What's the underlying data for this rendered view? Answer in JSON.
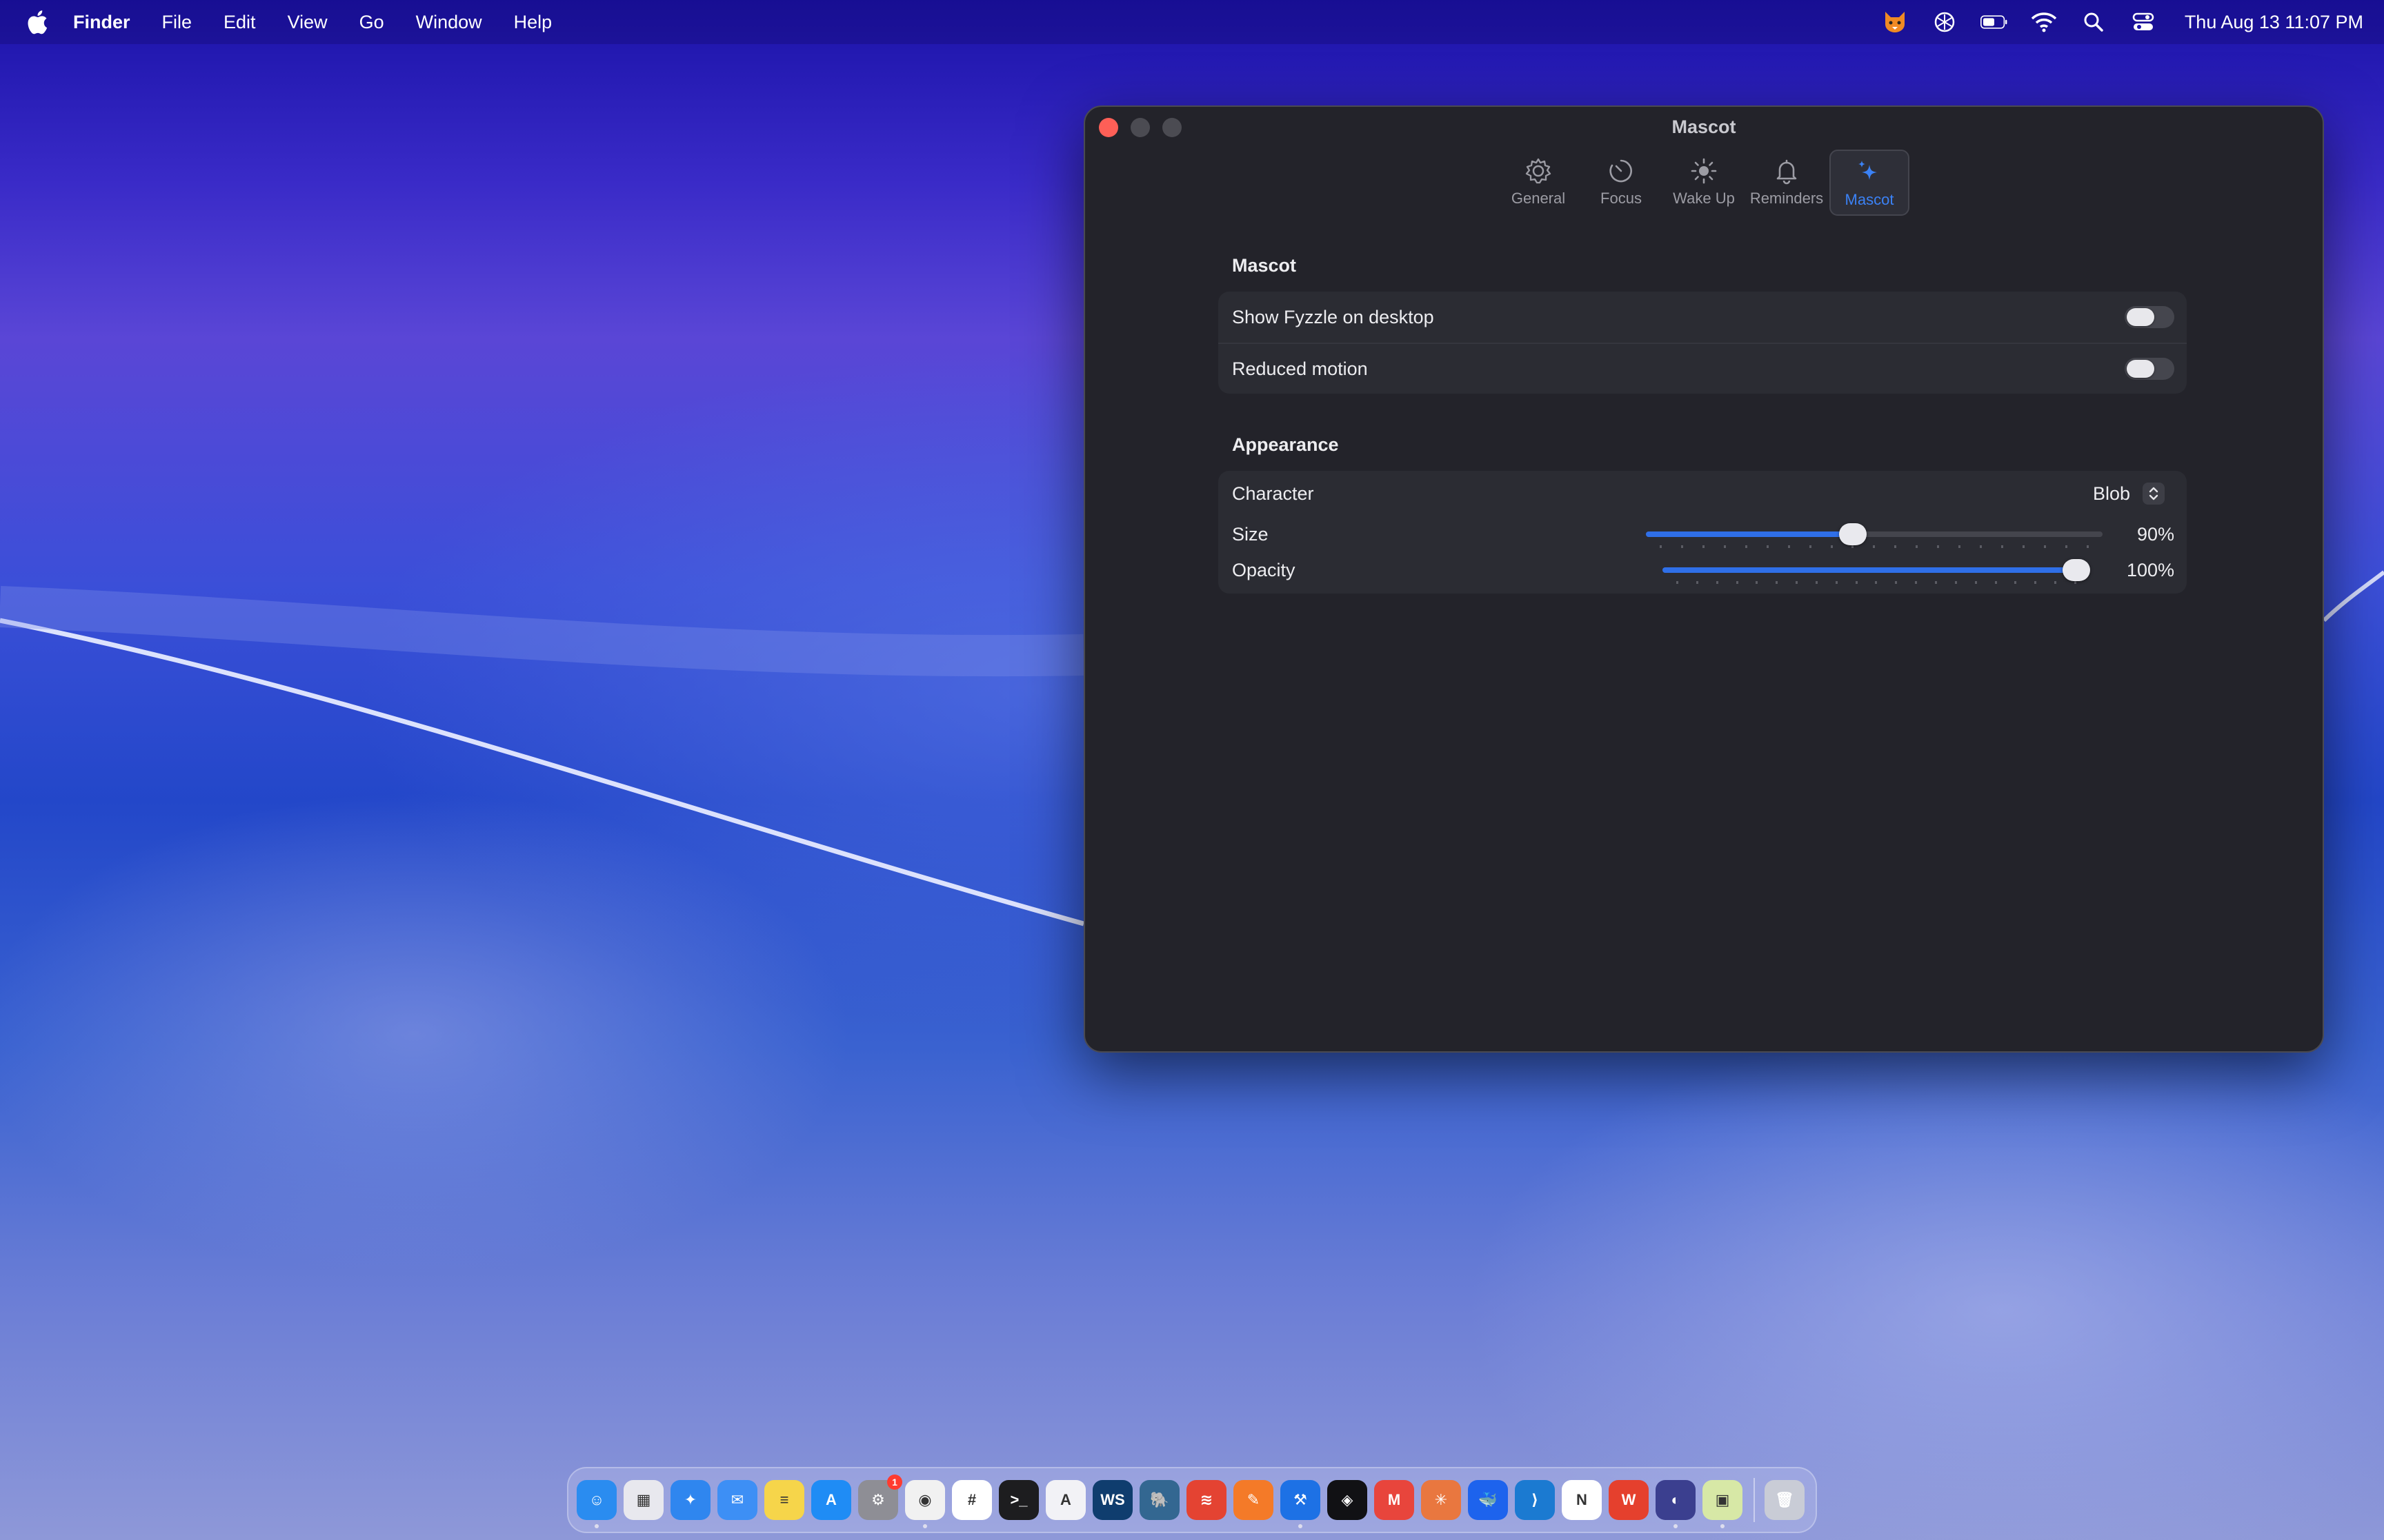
{
  "menubar": {
    "app_name": "Finder",
    "items": [
      "File",
      "Edit",
      "View",
      "Go",
      "Window",
      "Help"
    ],
    "status_icons": [
      "fox-app-icon",
      "chatgpt-icon",
      "battery-icon",
      "wifi-icon",
      "spotlight-search-icon",
      "control-center-icon"
    ],
    "clock": "Thu Aug 13  11:07 PM"
  },
  "window": {
    "title": "Mascot",
    "tabs": [
      {
        "label": "General",
        "icon": "gear-icon",
        "selected": false
      },
      {
        "label": "Focus",
        "icon": "timer-icon",
        "selected": false
      },
      {
        "label": "Wake Up",
        "icon": "sun-icon",
        "selected": false
      },
      {
        "label": "Reminders",
        "icon": "bell-icon",
        "selected": false
      },
      {
        "label": "Mascot",
        "icon": "sparkles-icon",
        "selected": true
      }
    ],
    "mascot_section": {
      "title": "Mascot",
      "show_on_desktop": {
        "label": "Show Fyzzle on desktop",
        "on": false
      },
      "reduced_motion": {
        "label": "Reduced motion",
        "on": false
      }
    },
    "appearance_section": {
      "title": "Appearance",
      "character": {
        "label": "Character",
        "value": "Blob"
      },
      "size": {
        "label": "Size",
        "value": "90%",
        "fraction": 0.45
      },
      "opacity": {
        "label": "Opacity",
        "value": "100%",
        "fraction": 1.0
      }
    }
  },
  "dock": {
    "apps": [
      {
        "name": "finder",
        "color": "#2a8cf0",
        "glyph": "☺",
        "running": true
      },
      {
        "name": "launchpad",
        "color": "#e8e8ee",
        "glyph": "▦",
        "running": false
      },
      {
        "name": "safari",
        "color": "#2f86ef",
        "glyph": "✦",
        "running": false
      },
      {
        "name": "mail",
        "color": "#3d8ff5",
        "glyph": "✉",
        "running": false
      },
      {
        "name": "notes",
        "color": "#f6d54a",
        "glyph": "≡",
        "running": false
      },
      {
        "name": "app-store",
        "color": "#1f8cf5",
        "glyph": "A",
        "running": false
      },
      {
        "name": "system-settings",
        "color": "#8e8e95",
        "glyph": "⚙",
        "running": false,
        "badge": "1"
      },
      {
        "name": "chrome",
        "color": "#f1f1f1",
        "glyph": "◉",
        "running": true
      },
      {
        "name": "slack",
        "color": "#ffffff",
        "glyph": "#",
        "running": false
      },
      {
        "name": "terminal",
        "color": "#1d1d1f",
        "glyph": ">_",
        "running": false
      },
      {
        "name": "instruments",
        "color": "#f2f2f6",
        "glyph": "A",
        "running": false
      },
      {
        "name": "webstorm",
        "color": "#0f3d6e",
        "glyph": "WS",
        "running": false
      },
      {
        "name": "postgres",
        "color": "#336791",
        "glyph": "🐘",
        "running": false
      },
      {
        "name": "todoist",
        "color": "#e44332",
        "glyph": "≋",
        "running": false
      },
      {
        "name": "swift-playgrounds",
        "color": "#f47a28",
        "glyph": "✎",
        "running": false
      },
      {
        "name": "xcode",
        "color": "#1d71e5",
        "glyph": "⚒",
        "running": true
      },
      {
        "name": "cube-app",
        "color": "#111114",
        "glyph": "◈",
        "running": false
      },
      {
        "name": "mimestream",
        "color": "#e8453c",
        "glyph": "M",
        "running": false
      },
      {
        "name": "claude",
        "color": "#e9773f",
        "glyph": "✳",
        "running": false
      },
      {
        "name": "docker",
        "color": "#1d63ed",
        "glyph": "🐳",
        "running": false
      },
      {
        "name": "vscode",
        "color": "#1b7ad1",
        "glyph": "⟩",
        "running": false
      },
      {
        "name": "notion",
        "color": "#ffffff",
        "glyph": "N",
        "running": false
      },
      {
        "name": "wps-office",
        "color": "#e5402d",
        "glyph": "W",
        "running": false
      },
      {
        "name": "simulator",
        "color": "#3b3f8f",
        "glyph": "◐",
        "running": true
      },
      {
        "name": "preview",
        "color": "#d7e8a6",
        "glyph": "▣",
        "running": true
      }
    ],
    "trash": {
      "name": "trash",
      "color": "#c9ccd6",
      "glyph": "🗑"
    }
  }
}
